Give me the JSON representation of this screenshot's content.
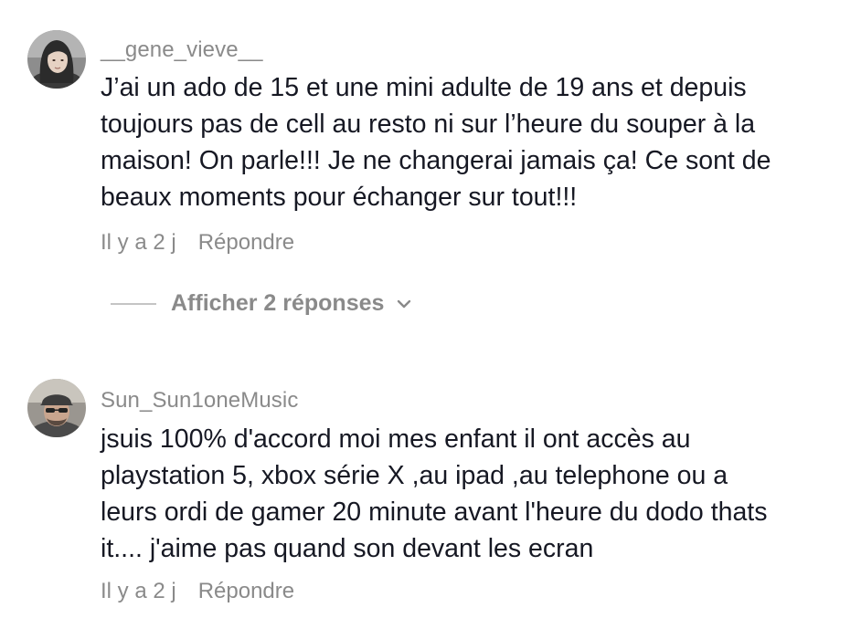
{
  "comments": [
    {
      "username": "__gene_vieve__",
      "text_lines": [
        "J’ai un ado de 15 et une mini adulte de 19 ans et depuis",
        "toujours pas de cell au resto ni sur l’heure du souper à la",
        "maison! On parle!!! Je ne changerai jamais ça! Ce sont de",
        "beaux moments pour échanger sur tout!!!"
      ],
      "time": "Il y a 2 j",
      "reply_label": "Répondre",
      "show_replies_label": "Afficher 2 réponses"
    },
    {
      "username": "Sun_Sun1oneMusic",
      "text_lines": [
        "jsuis 100% d'accord moi mes enfant il ont accès au",
        "playstation 5, xbox série X ,au ipad ,au telephone ou a",
        "leurs ordi de gamer 20 minute avant l'heure du dodo thats",
        "it.... j'aime pas quand son devant les ecran"
      ],
      "time": "Il y a 2 j",
      "reply_label": "Répondre"
    }
  ],
  "icons": {
    "expand": "chevron-down-icon"
  },
  "colors": {
    "text": "#161823",
    "meta": "#8a8a8a",
    "divider": "#c4c4c4"
  }
}
